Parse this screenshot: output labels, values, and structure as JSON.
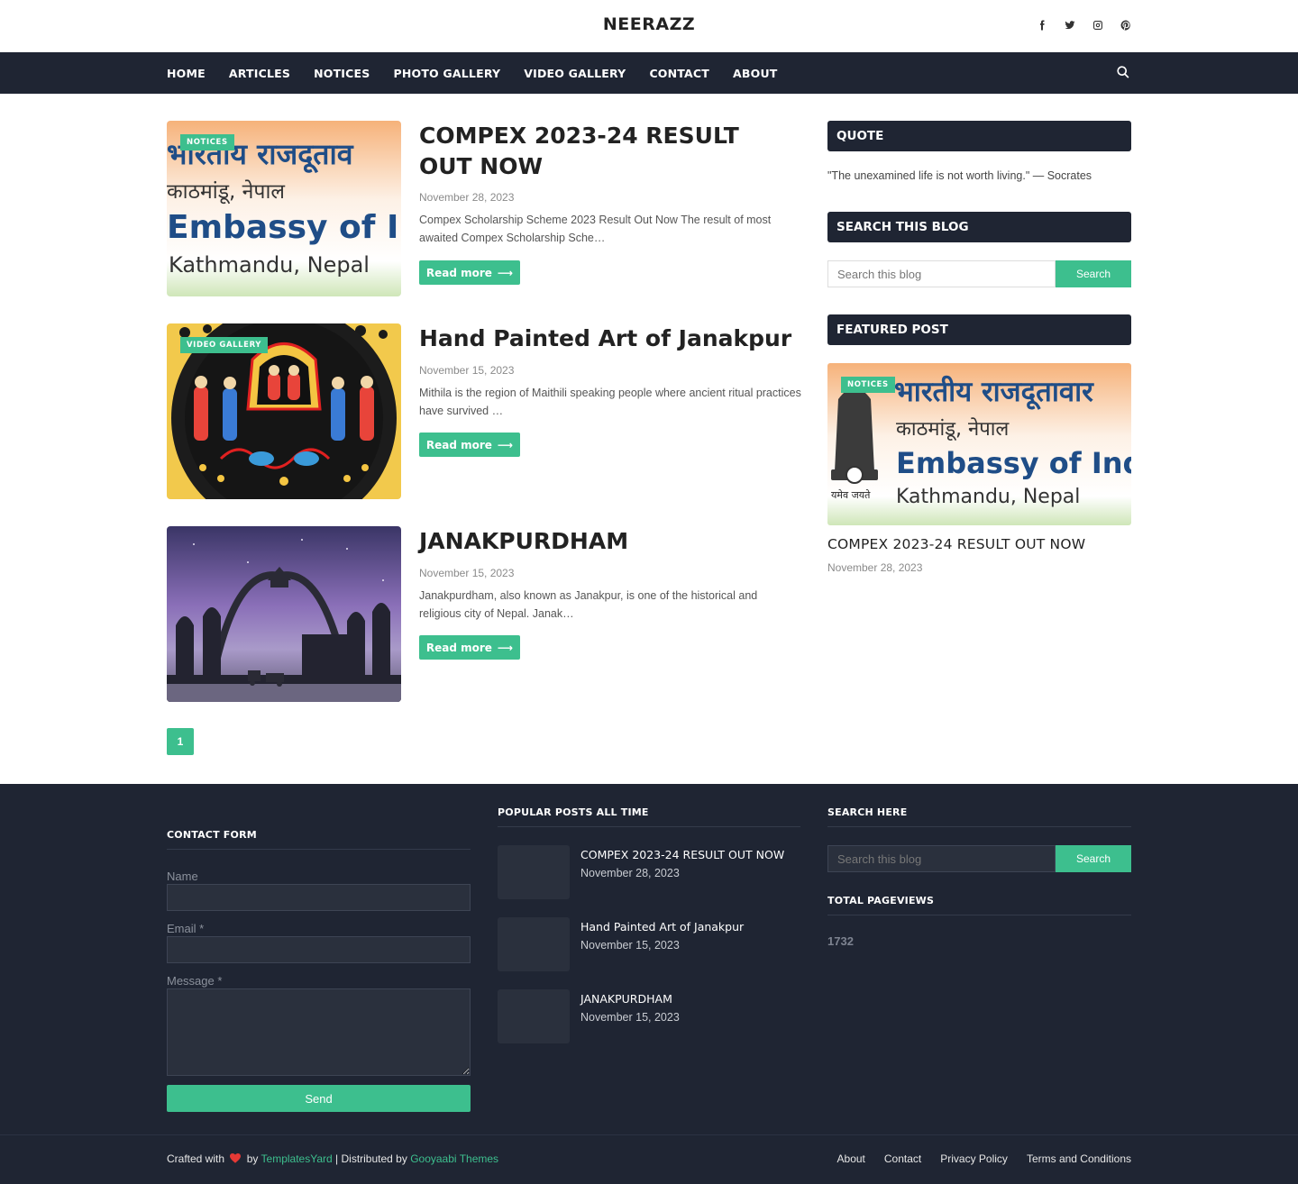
{
  "site": {
    "title": "NEERAZZ"
  },
  "social_icons": [
    "facebook-icon",
    "twitter-icon",
    "instagram-icon",
    "pinterest-icon"
  ],
  "nav": {
    "items": [
      "HOME",
      "ARTICLES",
      "NOTICES",
      "PHOTO GALLERY",
      "VIDEO GALLERY",
      "CONTACT",
      "ABOUT"
    ],
    "search_icon": "search-icon"
  },
  "posts": [
    {
      "label": "NOTICES",
      "title": "COMPEX 2023-24 RESULT OUT NOW",
      "date": "November 28, 2023",
      "excerpt": "Compex Scholarship Scheme 2023 Result Out Now  The result of most awaited Compex Scholarship Sche…",
      "read_more": "Read more",
      "image_text": {
        "line1": "भारतीय राजदूताव",
        "line2": "काठमांडू, नेपाल",
        "line3": "Embassy of In",
        "line4": "Kathmandu, Nepal"
      }
    },
    {
      "label": "VIDEO GALLERY",
      "title": "Hand Painted Art of Janakpur",
      "date": "November 15, 2023",
      "excerpt": "Mithila is the region of Maithili speaking people where ancient ritual practices have survived …",
      "read_more": "Read more"
    },
    {
      "label": "",
      "title": "JANAKPURDHAM",
      "date": "November 15, 2023",
      "excerpt": "Janakpurdham, also known as Janakpur, is one of the historical and religious city of Nepal. Janak…",
      "read_more": "Read more"
    }
  ],
  "pagination": {
    "current": "1"
  },
  "sidebar": {
    "quote": {
      "heading": "QUOTE",
      "text": "\"The unexamined life is not worth living.\" — Socrates"
    },
    "search": {
      "heading": "SEARCH THIS BLOG",
      "placeholder": "Search this blog",
      "button": "Search"
    },
    "featured": {
      "heading": "FEATURED POST",
      "label": "NOTICES",
      "title": "COMPEX 2023-24 RESULT OUT NOW",
      "date": "November 28, 2023",
      "image_text": {
        "line1": "भारतीय राजदूतावार",
        "line2": "काठमांडू, नेपाल",
        "line3": "Embassy of Ind",
        "line4": "Kathmandu, Nepal",
        "line5": "यमेव जयते"
      }
    }
  },
  "footer": {
    "contact": {
      "heading": "CONTACT FORM",
      "name_label": "Name",
      "email_label": "Email *",
      "message_label": "Message *",
      "send": "Send"
    },
    "popular": {
      "heading": "POPULAR POSTS ALL TIME",
      "items": [
        {
          "title": "COMPEX 2023-24 RESULT OUT NOW",
          "date": "November 28, 2023"
        },
        {
          "title": "Hand Painted Art of Janakpur",
          "date": "November 15, 2023"
        },
        {
          "title": "JANAKPURDHAM",
          "date": "November 15, 2023"
        }
      ]
    },
    "search": {
      "heading": "SEARCH HERE",
      "placeholder": "Search this blog",
      "button": "Search"
    },
    "pageviews": {
      "heading": "TOTAL PAGEVIEWS",
      "value": "1732"
    }
  },
  "bottom": {
    "crafted": "Crafted with",
    "by": "by",
    "templates_link": "TemplatesYard",
    "distributed": "| Distributed by",
    "gooyaabi_link": "Gooyaabi Themes",
    "links": [
      "About",
      "Contact",
      "Privacy Policy",
      "Terms and Conditions"
    ]
  },
  "colors": {
    "accent": "#3dbf8e",
    "dark": "#1f2533"
  }
}
